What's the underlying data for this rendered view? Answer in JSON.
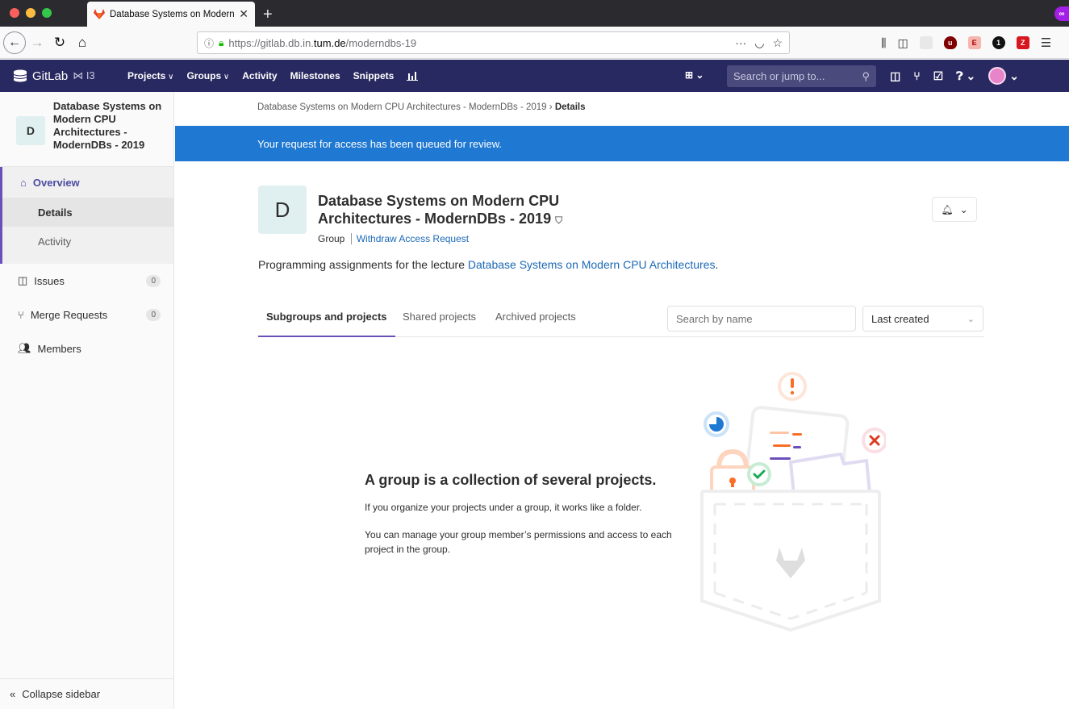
{
  "browser": {
    "tab_title": "Database Systems on Modern CPU Architectures",
    "url_host": "https://gitlab.db.in.",
    "url_domain": "tum.de",
    "url_path": "/moderndbs-19"
  },
  "header": {
    "logo_text": "GitLab",
    "logo_suffix": "⋈ I3",
    "menu": [
      "Projects",
      "Groups",
      "Activity",
      "Milestones",
      "Snippets"
    ],
    "search_placeholder": "Search or jump to..."
  },
  "sidebar": {
    "group_initial": "D",
    "group_name": "Database Systems on Modern CPU Architectures - ModernDBs - 2019",
    "overview": "Overview",
    "sub_items": [
      "Details",
      "Activity"
    ],
    "items": [
      {
        "label": "Issues",
        "count": "0"
      },
      {
        "label": "Merge Requests",
        "count": "0"
      },
      {
        "label": "Members"
      }
    ],
    "collapse_label": "Collapse sidebar"
  },
  "breadcrumb": {
    "parent": "Database Systems on Modern CPU Architectures - ModernDBs - 2019",
    "current": "Details"
  },
  "flash": "Your request for access has been queued for review.",
  "group": {
    "initial": "D",
    "title_line1": "Database Systems on Modern CPU",
    "title_line2": "Architectures - ModernDBs - 2019",
    "type": "Group",
    "withdraw_link": "Withdraw Access Request",
    "description_prefix": "Programming assignments for the lecture ",
    "description_link": "Database Systems on Modern CPU Architectures",
    "description_suffix": "."
  },
  "tabs": {
    "subgroups": "Subgroups and projects",
    "shared": "Shared projects",
    "archived": "Archived projects",
    "search_placeholder": "Search by name",
    "sort_value": "Last created"
  },
  "empty_state": {
    "title": "A group is a collection of several projects.",
    "p1": "If you organize your projects under a group, it works like a folder.",
    "p2": "You can manage your group member’s permissions and access to each project in the group."
  },
  "colors": {
    "header_bg": "#292961",
    "flash_bg": "#1f78d1",
    "accent": "#6b4fbb",
    "link": "#1b69b6"
  }
}
